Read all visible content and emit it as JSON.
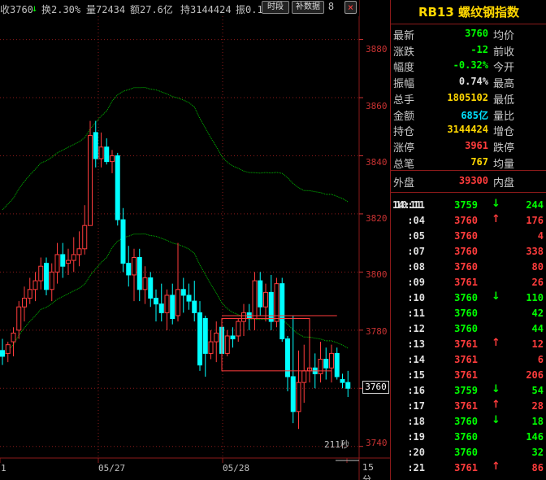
{
  "toolbar": {
    "items": [
      "收3760",
      "↓",
      "换2.30%",
      "量72434",
      "额27.6亿",
      "持3144424",
      "振0.1"
    ],
    "btn_timeframe": "时段",
    "btn_supplement": "补数据",
    "icon_menu": "8",
    "icon_close": "×",
    "icon_restore": "◇"
  },
  "yaxis": {
    "ticks": [
      "3880",
      "3860",
      "3840",
      "3820",
      "3800",
      "3780",
      "3760",
      "3740"
    ]
  },
  "xaxis": {
    "labels": [
      "1",
      "05/27",
      "05/28"
    ]
  },
  "last_price_tag": "3760",
  "countdown": "211秒",
  "period": "15分",
  "colors": {
    "up": "#ff3c3c",
    "down": "#00ffff",
    "flat_green": "#00ff00",
    "yellow": "#ffd700",
    "label": "#c8c8c8",
    "frame": "#8b1a1a"
  },
  "chart_data": {
    "type": "candlestick",
    "y_range": [
      3736,
      3888
    ],
    "candles": [
      {
        "o": 3773,
        "h": 3777,
        "l": 3768,
        "c": 3771
      },
      {
        "o": 3772,
        "h": 3776,
        "l": 3769,
        "c": 3775
      },
      {
        "o": 3776,
        "h": 3781,
        "l": 3771,
        "c": 3779
      },
      {
        "o": 3780,
        "h": 3790,
        "l": 3777,
        "c": 3788
      },
      {
        "o": 3788,
        "h": 3795,
        "l": 3783,
        "c": 3791
      },
      {
        "o": 3791,
        "h": 3798,
        "l": 3789,
        "c": 3794
      },
      {
        "o": 3794,
        "h": 3800,
        "l": 3790,
        "c": 3797
      },
      {
        "o": 3797,
        "h": 3805,
        "l": 3794,
        "c": 3802
      },
      {
        "o": 3803,
        "h": 3805,
        "l": 3792,
        "c": 3794
      },
      {
        "o": 3794,
        "h": 3803,
        "l": 3790,
        "c": 3800
      },
      {
        "o": 3800,
        "h": 3810,
        "l": 3796,
        "c": 3806
      },
      {
        "o": 3806,
        "h": 3810,
        "l": 3798,
        "c": 3802
      },
      {
        "o": 3803,
        "h": 3808,
        "l": 3799,
        "c": 3804
      },
      {
        "o": 3804,
        "h": 3812,
        "l": 3800,
        "c": 3806
      },
      {
        "o": 3806,
        "h": 3814,
        "l": 3802,
        "c": 3808
      },
      {
        "o": 3808,
        "h": 3823,
        "l": 3806,
        "c": 3816
      },
      {
        "o": 3816,
        "h": 3852,
        "l": 3816,
        "c": 3847
      },
      {
        "o": 3848,
        "h": 3852,
        "l": 3836,
        "c": 3839
      },
      {
        "o": 3839,
        "h": 3848,
        "l": 3836,
        "c": 3843
      },
      {
        "o": 3843,
        "h": 3846,
        "l": 3837,
        "c": 3838
      },
      {
        "o": 3838,
        "h": 3842,
        "l": 3834,
        "c": 3840
      },
      {
        "o": 3840,
        "h": 3841,
        "l": 3816,
        "c": 3818
      },
      {
        "o": 3818,
        "h": 3822,
        "l": 3800,
        "c": 3803
      },
      {
        "o": 3803,
        "h": 3809,
        "l": 3795,
        "c": 3799
      },
      {
        "o": 3799,
        "h": 3808,
        "l": 3790,
        "c": 3805
      },
      {
        "o": 3805,
        "h": 3808,
        "l": 3790,
        "c": 3794
      },
      {
        "o": 3794,
        "h": 3802,
        "l": 3789,
        "c": 3798
      },
      {
        "o": 3798,
        "h": 3800,
        "l": 3788,
        "c": 3791
      },
      {
        "o": 3791,
        "h": 3794,
        "l": 3783,
        "c": 3789
      },
      {
        "o": 3789,
        "h": 3796,
        "l": 3783,
        "c": 3786
      },
      {
        "o": 3786,
        "h": 3794,
        "l": 3780,
        "c": 3792
      },
      {
        "o": 3792,
        "h": 3796,
        "l": 3782,
        "c": 3784
      },
      {
        "o": 3785,
        "h": 3810,
        "l": 3783,
        "c": 3794
      },
      {
        "o": 3794,
        "h": 3798,
        "l": 3786,
        "c": 3792
      },
      {
        "o": 3792,
        "h": 3796,
        "l": 3787,
        "c": 3790
      },
      {
        "o": 3790,
        "h": 3797,
        "l": 3783,
        "c": 3786
      },
      {
        "o": 3786,
        "h": 3790,
        "l": 3766,
        "c": 3768
      },
      {
        "o": 3784,
        "h": 3785,
        "l": 3764,
        "c": 3772
      },
      {
        "o": 3772,
        "h": 3780,
        "l": 3770,
        "c": 3776
      },
      {
        "o": 3776,
        "h": 3783,
        "l": 3769,
        "c": 3779
      },
      {
        "o": 3781,
        "h": 3784,
        "l": 3771,
        "c": 3772
      },
      {
        "o": 3772,
        "h": 3780,
        "l": 3771,
        "c": 3778
      },
      {
        "o": 3778,
        "h": 3781,
        "l": 3774,
        "c": 3777
      },
      {
        "o": 3778,
        "h": 3784,
        "l": 3776,
        "c": 3783
      },
      {
        "o": 3783,
        "h": 3789,
        "l": 3778,
        "c": 3786
      },
      {
        "o": 3786,
        "h": 3789,
        "l": 3780,
        "c": 3784
      },
      {
        "o": 3784,
        "h": 3800,
        "l": 3780,
        "c": 3797
      },
      {
        "o": 3797,
        "h": 3800,
        "l": 3785,
        "c": 3788
      },
      {
        "o": 3788,
        "h": 3796,
        "l": 3783,
        "c": 3793
      },
      {
        "o": 3793,
        "h": 3799,
        "l": 3780,
        "c": 3783
      },
      {
        "o": 3783,
        "h": 3798,
        "l": 3781,
        "c": 3796
      },
      {
        "o": 3796,
        "h": 3798,
        "l": 3776,
        "c": 3777
      },
      {
        "o": 3777,
        "h": 3778,
        "l": 3759,
        "c": 3764
      },
      {
        "o": 3764,
        "h": 3785,
        "l": 3748,
        "c": 3752
      },
      {
        "o": 3752,
        "h": 3773,
        "l": 3746,
        "c": 3762
      },
      {
        "o": 3762,
        "h": 3775,
        "l": 3755,
        "c": 3766
      },
      {
        "o": 3766,
        "h": 3771,
        "l": 3762,
        "c": 3767
      },
      {
        "o": 3767,
        "h": 3772,
        "l": 3760,
        "c": 3765
      },
      {
        "o": 3765,
        "h": 3776,
        "l": 3762,
        "c": 3770
      },
      {
        "o": 3770,
        "h": 3774,
        "l": 3763,
        "c": 3767
      },
      {
        "o": 3767,
        "h": 3775,
        "l": 3762,
        "c": 3772
      },
      {
        "o": 3772,
        "h": 3774,
        "l": 3763,
        "c": 3764
      },
      {
        "o": 3763,
        "h": 3765,
        "l": 3760,
        "c": 3762
      },
      {
        "o": 3762,
        "h": 3766,
        "l": 3757,
        "c": 3760
      }
    ]
  },
  "quote": {
    "title": "RB13  螺纹钢指数",
    "rows": [
      {
        "label": "最新",
        "value": "3760",
        "color": "#00ff00",
        "label2": "均价"
      },
      {
        "label": "涨跌",
        "value": "-12",
        "color": "#00ff00",
        "label2": "前收"
      },
      {
        "label": "幅度",
        "value": "-0.32%",
        "color": "#00ff00",
        "label2": "今开"
      },
      {
        "label": "振幅",
        "value": "0.74%",
        "color": "#e0e0e0",
        "label2": "最高"
      },
      {
        "label": "总手",
        "value": "1805102",
        "color": "#ffd700",
        "label2": "最低"
      },
      {
        "label": "金额",
        "value": "685亿",
        "color": "#00e0ff",
        "label2": "量比"
      },
      {
        "label": "持仓",
        "value": "3144424",
        "color": "#ffd700",
        "label2": "增仓"
      },
      {
        "label": "涨停",
        "value": "3961",
        "color": "#ff3c3c",
        "label2": "跌停"
      },
      {
        "label": "总笔",
        "value": "767",
        "color": "#ffd700",
        "label2": "均量"
      }
    ],
    "outer": {
      "label": "外盘",
      "value": "39300",
      "color": "#ff3c3c",
      "label2": "内盘"
    }
  },
  "ticks": {
    "header_date": "14:11",
    "rows": [
      {
        "time": "10:11",
        "price": "3759",
        "arrow": "↓",
        "arrow_color": "#00ff00",
        "vol": "244",
        "vol_color": "#00ff00"
      },
      {
        "time": ":04",
        "price": "3760",
        "arrow": "↑",
        "arrow_color": "#ff3c3c",
        "vol": "176",
        "vol_color": "#ff3c3c"
      },
      {
        "time": ":05",
        "price": "3760",
        "arrow": "",
        "arrow_color": "#000000",
        "vol": "4",
        "vol_color": "#ff3c3c"
      },
      {
        "time": ":07",
        "price": "3760",
        "arrow": "",
        "arrow_color": "#000000",
        "vol": "338",
        "vol_color": "#ff3c3c"
      },
      {
        "time": ":08",
        "price": "3760",
        "arrow": "",
        "arrow_color": "#000000",
        "vol": "80",
        "vol_color": "#ff3c3c"
      },
      {
        "time": ":09",
        "price": "3761",
        "arrow": "",
        "arrow_color": "#000000",
        "vol": "26",
        "vol_color": "#ff3c3c"
      },
      {
        "time": ":10",
        "price": "3760",
        "arrow": "↓",
        "arrow_color": "#00ff00",
        "vol": "110",
        "vol_color": "#00ff00"
      },
      {
        "time": ":11",
        "price": "3760",
        "arrow": "",
        "arrow_color": "#000000",
        "vol": "42",
        "vol_color": "#00ff00"
      },
      {
        "time": ":12",
        "price": "3760",
        "arrow": "",
        "arrow_color": "#000000",
        "vol": "44",
        "vol_color": "#00ff00"
      },
      {
        "time": ":13",
        "price": "3761",
        "arrow": "↑",
        "arrow_color": "#ff3c3c",
        "vol": "12",
        "vol_color": "#ff3c3c"
      },
      {
        "time": ":14",
        "price": "3761",
        "arrow": "",
        "arrow_color": "#000000",
        "vol": "6",
        "vol_color": "#ff3c3c"
      },
      {
        "time": ":15",
        "price": "3761",
        "arrow": "",
        "arrow_color": "#000000",
        "vol": "206",
        "vol_color": "#ff3c3c"
      },
      {
        "time": ":16",
        "price": "3759",
        "arrow": "↓",
        "arrow_color": "#00ff00",
        "vol": "54",
        "vol_color": "#00ff00"
      },
      {
        "time": ":17",
        "price": "3761",
        "arrow": "↑",
        "arrow_color": "#ff3c3c",
        "vol": "28",
        "vol_color": "#ff3c3c"
      },
      {
        "time": ":18",
        "price": "3760",
        "arrow": "↓",
        "arrow_color": "#00ff00",
        "vol": "18",
        "vol_color": "#00ff00"
      },
      {
        "time": ":19",
        "price": "3760",
        "arrow": "",
        "arrow_color": "#000000",
        "vol": "146",
        "vol_color": "#00ff00"
      },
      {
        "time": ":20",
        "price": "3760",
        "arrow": "",
        "arrow_color": "#000000",
        "vol": "32",
        "vol_color": "#00ff00"
      },
      {
        "time": ":21",
        "price": "3761",
        "arrow": "↑",
        "arrow_color": "#ff3c3c",
        "vol": "86",
        "vol_color": "#ff3c3c"
      }
    ]
  }
}
